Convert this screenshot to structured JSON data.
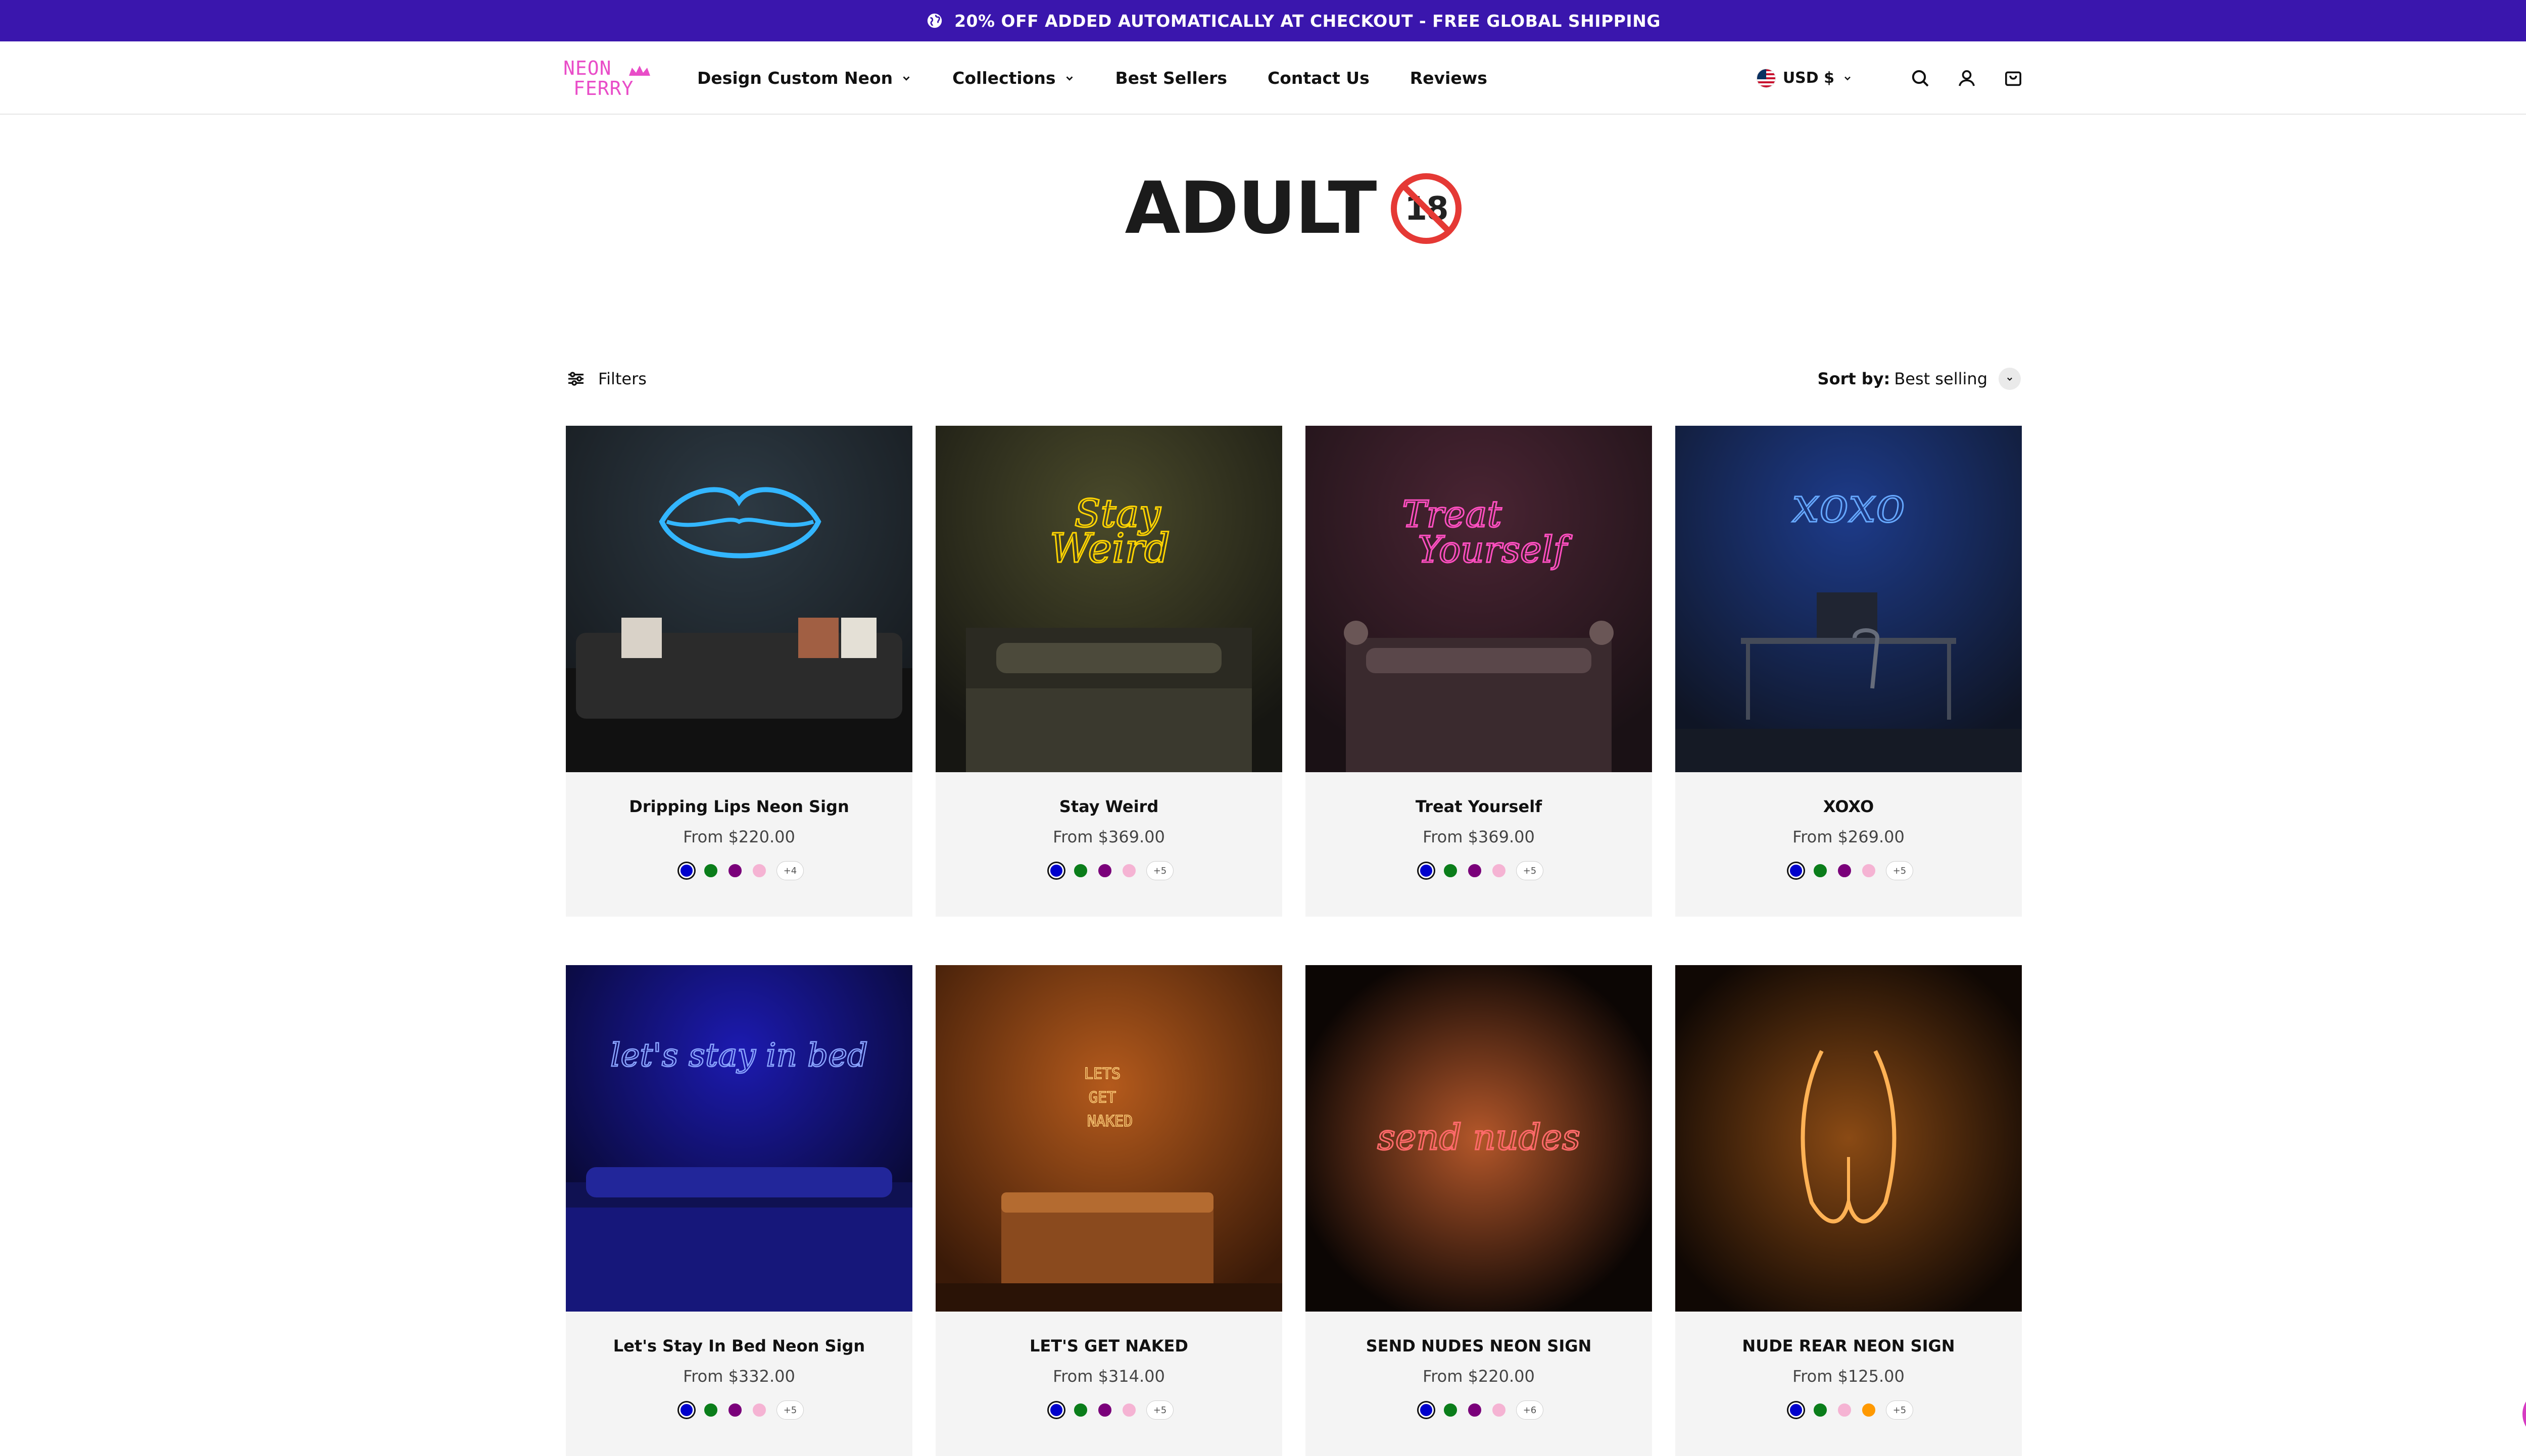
{
  "announcement": {
    "text": "20% OFF ADDED AUTOMATICALLY AT CHECKOUT - FREE GLOBAL SHIPPING",
    "icon": "globe-icon"
  },
  "brand": {
    "line1": "NEON",
    "line2": "FERRY",
    "color": "#e94dc8"
  },
  "nav": [
    {
      "label": "Design Custom Neon",
      "has_dropdown": true
    },
    {
      "label": "Collections",
      "has_dropdown": true
    },
    {
      "label": "Best Sellers",
      "has_dropdown": false
    },
    {
      "label": "Contact Us",
      "has_dropdown": false
    },
    {
      "label": "Reviews",
      "has_dropdown": false
    }
  ],
  "header_right": {
    "currency": "USD $",
    "icons": [
      "search-icon",
      "account-icon",
      "cart-icon"
    ]
  },
  "page": {
    "title": "ADULT",
    "badge_icon": "no-under-18-icon"
  },
  "toolbar": {
    "filters_label": "Filters",
    "sort_label": "Sort by:",
    "sort_value": "Best selling"
  },
  "products": [
    {
      "name": "Dripping Lips Neon Sign",
      "price": "From $220.00",
      "more": "+4",
      "swatches": [
        "#0000cc",
        "#0a7d1a",
        "#7a007a",
        "#f5b3d3"
      ]
    },
    {
      "name": "Stay Weird",
      "price": "From $369.00",
      "more": "+5",
      "swatches": [
        "#0000cc",
        "#0a7d1a",
        "#7a007a",
        "#f5b3d3"
      ]
    },
    {
      "name": "Treat Yourself",
      "price": "From $369.00",
      "more": "+5",
      "swatches": [
        "#0000cc",
        "#0a7d1a",
        "#7a007a",
        "#f5b3d3"
      ]
    },
    {
      "name": "XOXO",
      "price": "From $269.00",
      "more": "+5",
      "swatches": [
        "#0000cc",
        "#0a7d1a",
        "#7a007a",
        "#f5b3d3"
      ]
    },
    {
      "name": "Let's Stay In Bed Neon Sign",
      "price": "From $332.00",
      "more": "+5",
      "swatches": [
        "#0000cc",
        "#0a7d1a",
        "#7a007a",
        "#f5b3d3"
      ]
    },
    {
      "name": "LET'S GET NAKED",
      "price": "From $314.00",
      "more": "+5",
      "swatches": [
        "#0000cc",
        "#0a7d1a",
        "#7a007a",
        "#f5b3d3"
      ]
    },
    {
      "name": "SEND NUDES NEON SIGN",
      "price": "From $220.00",
      "more": "+6",
      "swatches": [
        "#0000cc",
        "#0a7d1a",
        "#7a007a",
        "#f5b3d3"
      ]
    },
    {
      "name": "NUDE REAR NEON SIGN",
      "price": "From $125.00",
      "more": "+5",
      "swatches": [
        "#0000cc",
        "#0a7d1a",
        "#f5b3d3",
        "#ff9900"
      ]
    }
  ],
  "sign_texts": {
    "p1": "",
    "p2a": "Stay",
    "p2b": "Weird",
    "p3a": "Treat",
    "p3b": "Yourself",
    "p4": "xoxo",
    "p5": "let's stay in bed",
    "p6a": "LETS",
    "p6b": "GET",
    "p6c": "NAKED",
    "p7": "send nudes"
  },
  "colors": {
    "announcement_bg": "#3a16ad",
    "card_bg": "#f4f4f4",
    "whatsapp_bg": "#d63bc2"
  },
  "floating": {
    "icon": "whatsapp-icon"
  }
}
